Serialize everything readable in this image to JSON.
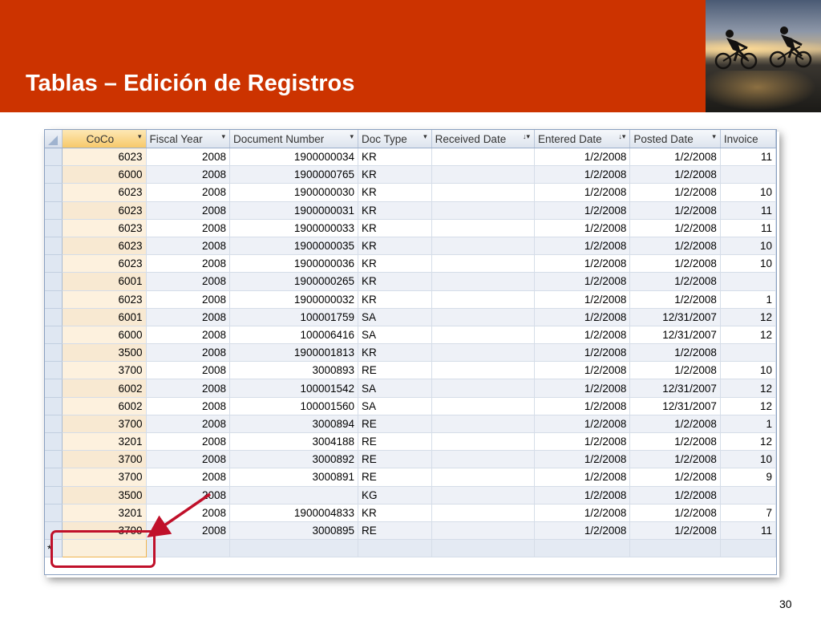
{
  "slide": {
    "title": "Tablas – Edición de Registros",
    "page_number": "30",
    "banner_color": "#CC3300",
    "annotation_color": "#C0102A"
  },
  "table": {
    "columns": [
      {
        "label": "CoCo",
        "sort_icon": "dropdown-arrow-icon"
      },
      {
        "label": "Fiscal Year",
        "sort_icon": "dropdown-arrow-icon"
      },
      {
        "label": "Document Number",
        "sort_icon": "dropdown-arrow-icon"
      },
      {
        "label": "Doc Type",
        "sort_icon": "dropdown-arrow-icon"
      },
      {
        "label": "Received Date",
        "sort_icon": "sort-descending-icon"
      },
      {
        "label": "Entered Date",
        "sort_icon": "sort-descending-icon"
      },
      {
        "label": "Posted Date",
        "sort_icon": "dropdown-arrow-icon"
      },
      {
        "label": "Invoice",
        "sort_icon": ""
      }
    ],
    "rows": [
      [
        "6023",
        "2008",
        "1900000034",
        "KR",
        "",
        "1/2/2008",
        "1/2/2008",
        "11"
      ],
      [
        "6000",
        "2008",
        "1900000765",
        "KR",
        "",
        "1/2/2008",
        "1/2/2008",
        ""
      ],
      [
        "6023",
        "2008",
        "1900000030",
        "KR",
        "",
        "1/2/2008",
        "1/2/2008",
        "10"
      ],
      [
        "6023",
        "2008",
        "1900000031",
        "KR",
        "",
        "1/2/2008",
        "1/2/2008",
        "11"
      ],
      [
        "6023",
        "2008",
        "1900000033",
        "KR",
        "",
        "1/2/2008",
        "1/2/2008",
        "11"
      ],
      [
        "6023",
        "2008",
        "1900000035",
        "KR",
        "",
        "1/2/2008",
        "1/2/2008",
        "10"
      ],
      [
        "6023",
        "2008",
        "1900000036",
        "KR",
        "",
        "1/2/2008",
        "1/2/2008",
        "10"
      ],
      [
        "6001",
        "2008",
        "1900000265",
        "KR",
        "",
        "1/2/2008",
        "1/2/2008",
        ""
      ],
      [
        "6023",
        "2008",
        "1900000032",
        "KR",
        "",
        "1/2/2008",
        "1/2/2008",
        "1"
      ],
      [
        "6001",
        "2008",
        "100001759",
        "SA",
        "",
        "1/2/2008",
        "12/31/2007",
        "12"
      ],
      [
        "6000",
        "2008",
        "100006416",
        "SA",
        "",
        "1/2/2008",
        "12/31/2007",
        "12"
      ],
      [
        "3500",
        "2008",
        "1900001813",
        "KR",
        "",
        "1/2/2008",
        "1/2/2008",
        ""
      ],
      [
        "3700",
        "2008",
        "3000893",
        "RE",
        "",
        "1/2/2008",
        "1/2/2008",
        "10"
      ],
      [
        "6002",
        "2008",
        "100001542",
        "SA",
        "",
        "1/2/2008",
        "12/31/2007",
        "12"
      ],
      [
        "6002",
        "2008",
        "100001560",
        "SA",
        "",
        "1/2/2008",
        "12/31/2007",
        "12"
      ],
      [
        "3700",
        "2008",
        "3000894",
        "RE",
        "",
        "1/2/2008",
        "1/2/2008",
        "1"
      ],
      [
        "3201",
        "2008",
        "3004188",
        "RE",
        "",
        "1/2/2008",
        "1/2/2008",
        "12"
      ],
      [
        "3700",
        "2008",
        "3000892",
        "RE",
        "",
        "1/2/2008",
        "1/2/2008",
        "10"
      ],
      [
        "3700",
        "2008",
        "3000891",
        "RE",
        "",
        "1/2/2008",
        "1/2/2008",
        "9"
      ],
      [
        "3500",
        "2008",
        "",
        "KG",
        "",
        "1/2/2008",
        "1/2/2008",
        ""
      ],
      [
        "3201",
        "2008",
        "1900004833",
        "KR",
        "",
        "1/2/2008",
        "1/2/2008",
        "7"
      ],
      [
        "3700",
        "2008",
        "3000895",
        "RE",
        "",
        "1/2/2008",
        "1/2/2008",
        "11"
      ]
    ],
    "new_record_marker": "*"
  }
}
